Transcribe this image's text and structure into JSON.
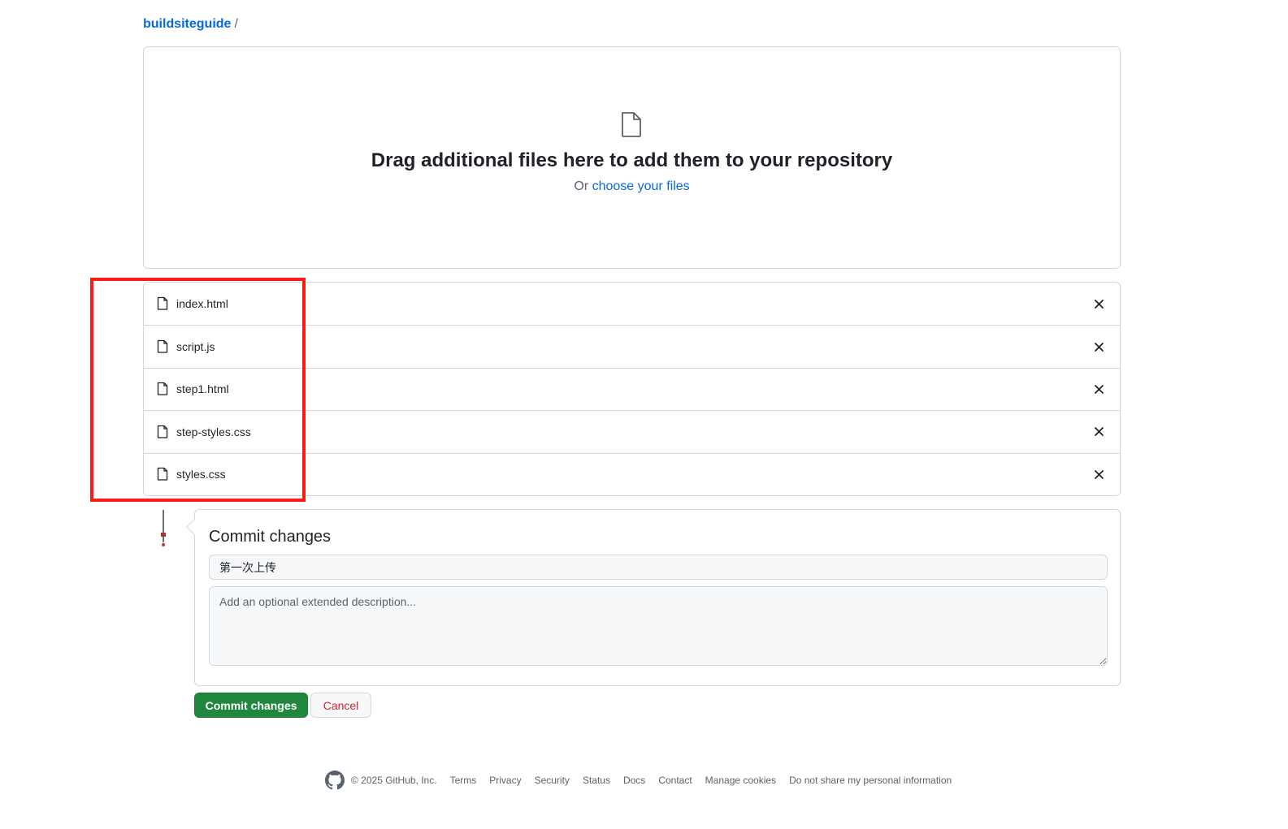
{
  "breadcrumb": {
    "repo": "buildsiteguide",
    "separator": "/"
  },
  "dropzone": {
    "icon": "file-icon",
    "heading": "Drag additional files here to add them to your repository",
    "or_text": "Or",
    "choose_link": "choose your files"
  },
  "files": [
    {
      "name": "index.html"
    },
    {
      "name": "script.js"
    },
    {
      "name": "step1.html"
    },
    {
      "name": "step-styles.css"
    },
    {
      "name": "styles.css"
    }
  ],
  "highlight": {
    "color": "#ff1a1a"
  },
  "commit": {
    "heading": "Commit changes",
    "summary_value": "第一次上传",
    "description_placeholder": "Add an optional extended description...",
    "commit_button": "Commit changes",
    "cancel_button": "Cancel"
  },
  "footer": {
    "copyright": "© 2025 GitHub, Inc.",
    "links": [
      "Terms",
      "Privacy",
      "Security",
      "Status",
      "Docs",
      "Contact",
      "Manage cookies",
      "Do not share my personal information"
    ]
  },
  "colors": {
    "accent": "#0969da",
    "primary_button": "#1f883d",
    "danger": "#d1242f",
    "border": "#d1d9e0"
  }
}
